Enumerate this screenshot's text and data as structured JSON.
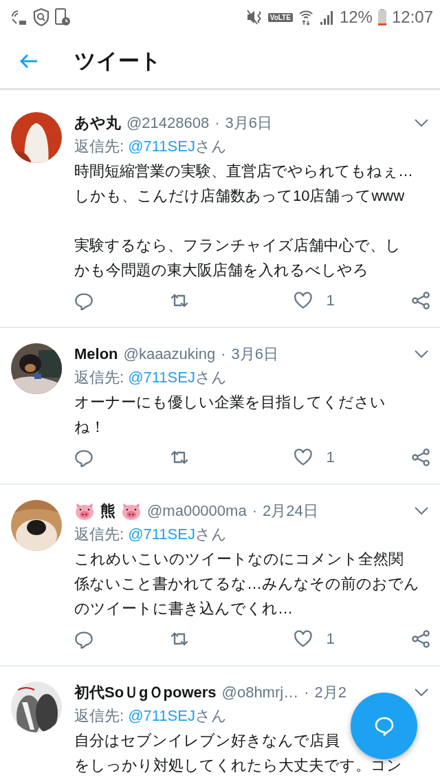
{
  "status_bar": {
    "network_badge": "VoLTE",
    "battery": "12%",
    "time": "12:07"
  },
  "header": {
    "title": "ツイート"
  },
  "tweets": [
    {
      "avatar": {
        "kind": "picture"
      },
      "name": "あや丸",
      "decorated": false,
      "handle": "@21428608",
      "separator": "·",
      "date": "3月6日",
      "reply_label": "返信先:",
      "reply_to": "@711SEJ",
      "reply_suffix": "さん",
      "paragraphs": [
        [
          "時間短縮営業の実験、直営店でやられてもねぇ…",
          "しかも、こんだけ店舗数あって10店舗ってwww"
        ],
        [
          "実験するなら、フランチャイズ店舗中心で、し",
          "かも今問題の東大阪店舗を入れるべしやろ"
        ]
      ],
      "likes": "1"
    },
    {
      "avatar": {
        "kind": "picture"
      },
      "name": "Melon",
      "decorated": false,
      "handle": "@kaaazuking",
      "separator": "·",
      "date": "3月6日",
      "reply_label": "返信先:",
      "reply_to": "@711SEJ",
      "reply_suffix": "さん",
      "paragraphs": [
        [
          "オーナーにも優しい企業を目指してください",
          "ね！"
        ]
      ],
      "likes": "1"
    },
    {
      "avatar": {
        "kind": "picture"
      },
      "name": "熊",
      "decorated": true,
      "handle": "@ma00000ma",
      "separator": "·",
      "date": "2月24日",
      "reply_label": "返信先:",
      "reply_to": "@711SEJ",
      "reply_suffix": "さん",
      "paragraphs": [
        [
          "これめいこいのツイートなのにコメント全然関",
          "係ないこと書かれてるな…みんなその前のおでん",
          "のツイートに書き込んでくれ…"
        ]
      ],
      "likes": "1"
    },
    {
      "avatar": {
        "kind": "picture"
      },
      "name": "初代SoＵgＯpowers",
      "decorated": false,
      "handle": "@o8hmrj…",
      "separator": "·",
      "date": "2月2",
      "reply_label": "返信先:",
      "reply_to": "@711SEJ",
      "reply_suffix": "さん",
      "paragraphs": [
        [
          "自分はセブンイレブン好きなんで店員",
          "をしっかり対処してくれたら大丈夫です。コン"
        ]
      ]
    }
  ]
}
